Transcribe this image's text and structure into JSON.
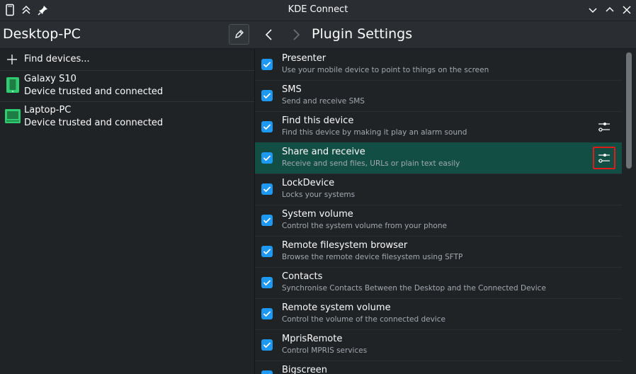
{
  "window": {
    "title": "KDE Connect",
    "icons": [
      "app-phone-icon",
      "keep-above-icon",
      "pin-icon",
      "minimize-icon",
      "maximize-icon",
      "close-icon"
    ]
  },
  "header": {
    "device_title": "Desktop-PC",
    "page_title": "Plugin Settings"
  },
  "sidebar": {
    "find_label": "Find devices...",
    "devices": [
      {
        "name": "Galaxy S10",
        "status": "Device trusted and connected",
        "icon": "phone-icon"
      },
      {
        "name": "Laptop-PC",
        "status": "Device trusted and connected",
        "icon": "laptop-icon"
      }
    ]
  },
  "plugins": [
    {
      "name": "Presenter",
      "desc": "Use your mobile device to point to things on the screen",
      "checked": true,
      "has_config": false
    },
    {
      "name": "SMS",
      "desc": "Send and receive SMS",
      "checked": true,
      "has_config": false
    },
    {
      "name": "Find this device",
      "desc": "Find this device by making it play an alarm sound",
      "checked": true,
      "has_config": true
    },
    {
      "name": "Share and receive",
      "desc": "Receive and send files, URLs or plain text easily",
      "checked": true,
      "has_config": true,
      "selected": true
    },
    {
      "name": "LockDevice",
      "desc": "Locks your systems",
      "checked": true,
      "has_config": false
    },
    {
      "name": "System volume",
      "desc": "Control the system volume from your phone",
      "checked": true,
      "has_config": false
    },
    {
      "name": "Remote filesystem browser",
      "desc": "Browse the remote device filesystem using SFTP",
      "checked": true,
      "has_config": false
    },
    {
      "name": "Contacts",
      "desc": "Synchronise Contacts Between the Desktop and the Connected Device",
      "checked": true,
      "has_config": false
    },
    {
      "name": "Remote system volume",
      "desc": "Control the volume of the connected device",
      "checked": true,
      "has_config": false
    },
    {
      "name": "MprisRemote",
      "desc": "Control MPRIS services",
      "checked": true,
      "has_config": false
    },
    {
      "name": "Bigscreen",
      "desc": "",
      "checked": true,
      "has_config": false
    }
  ],
  "colors": {
    "accent": "#1d99f3",
    "selected_row": "#134e44",
    "highlight_outline": "#e01b1b",
    "device_icon": "#2ecc71"
  }
}
